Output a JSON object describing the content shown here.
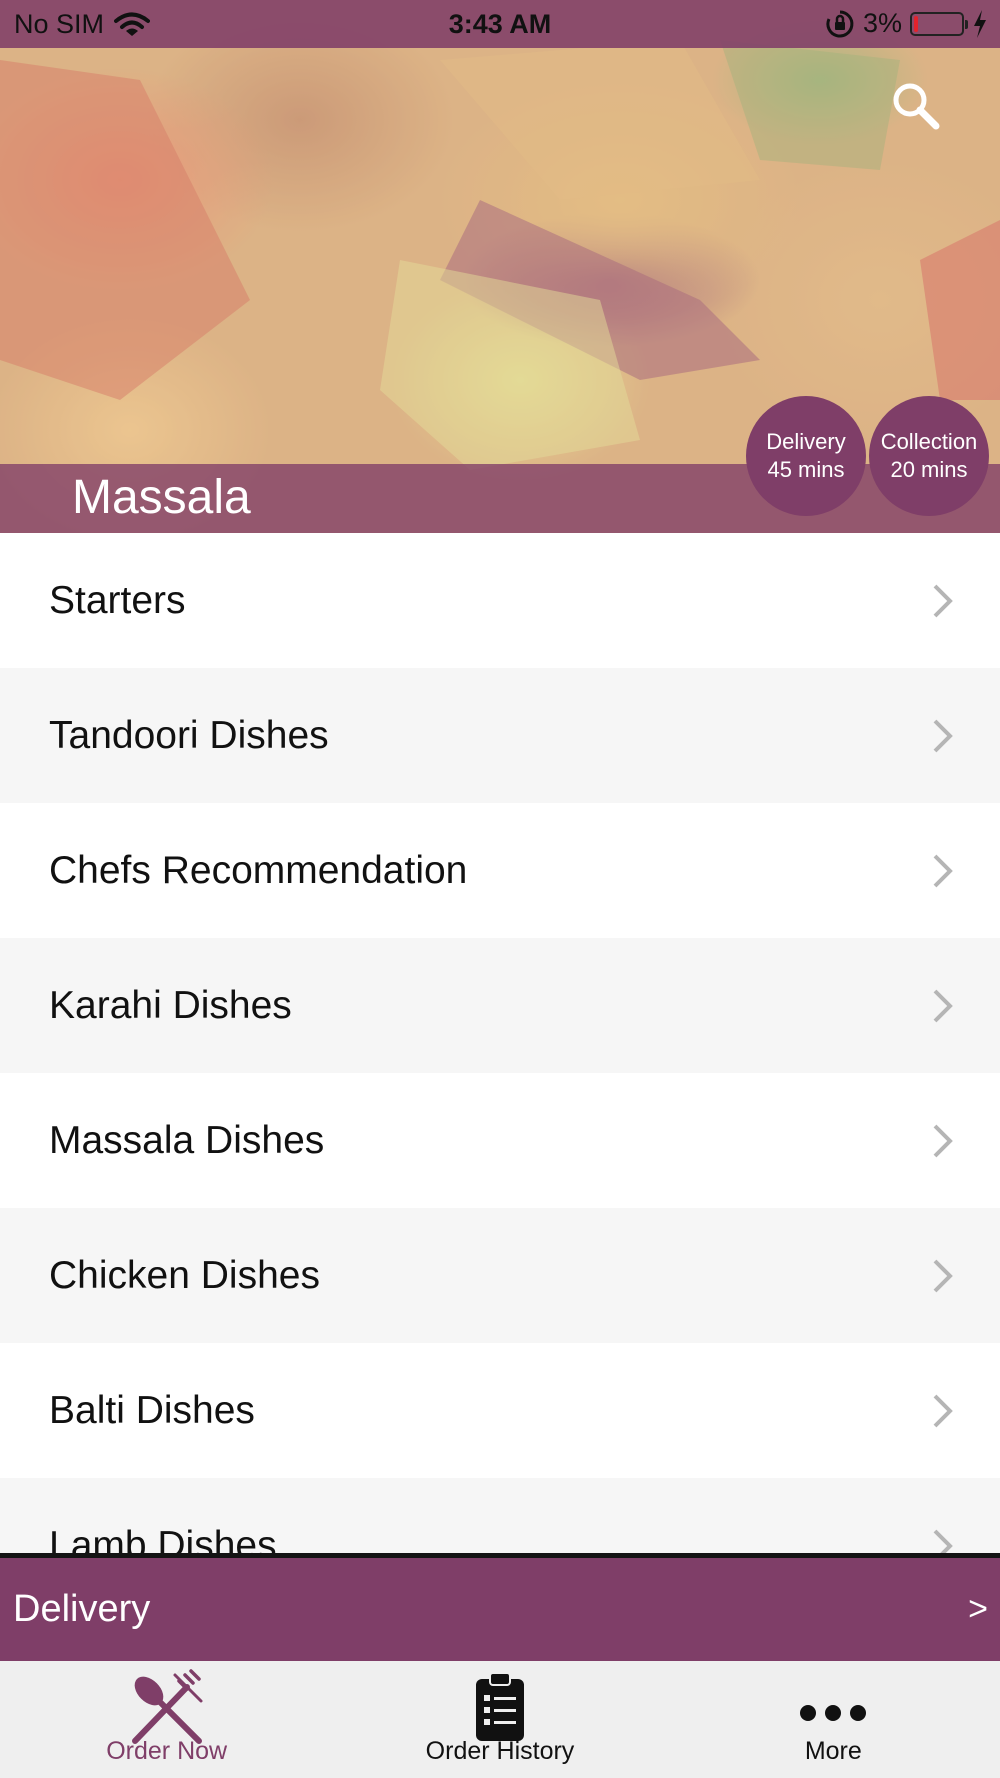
{
  "status_bar": {
    "carrier": "No SIM",
    "time": "3:43 AM",
    "battery": "3%"
  },
  "header": {
    "restaurant_name": "Massala",
    "delivery": {
      "label": "Delivery",
      "time": "45 mins"
    },
    "collection": {
      "label": "Collection",
      "time": "20 mins"
    }
  },
  "categories": [
    {
      "label": "Starters"
    },
    {
      "label": "Tandoori Dishes"
    },
    {
      "label": "Chefs Recommendation"
    },
    {
      "label": "Karahi Dishes"
    },
    {
      "label": "Massala Dishes"
    },
    {
      "label": "Chicken Dishes"
    },
    {
      "label": "Balti Dishes"
    },
    {
      "label": "Lamb Dishes"
    }
  ],
  "order_bar": {
    "mode": "Delivery",
    "arrow": ">"
  },
  "tabs": [
    {
      "label": "Order Now",
      "icon": "fork-knife-icon",
      "active": true
    },
    {
      "label": "Order History",
      "icon": "clipboard-list-icon",
      "active": false
    },
    {
      "label": "More",
      "icon": "more-dots-icon",
      "active": false
    }
  ],
  "colors": {
    "brand": "#7f3e68",
    "tab_active": "#7f3e68",
    "tab_bar": "#efefef",
    "row_alt": "#f6f6f6"
  }
}
